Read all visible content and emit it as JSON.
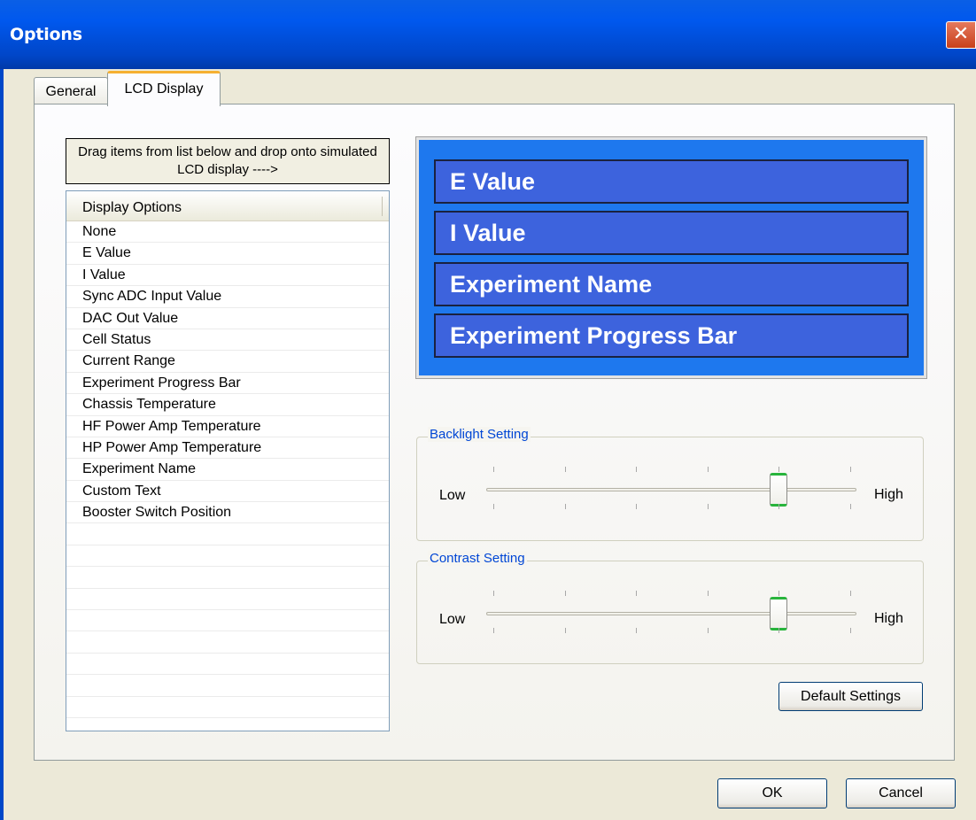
{
  "window": {
    "title": "Options",
    "close_glyph": "✕"
  },
  "tabs": [
    {
      "label": "General",
      "active": false
    },
    {
      "label": "LCD Display",
      "active": true
    }
  ],
  "left": {
    "hint": "Drag items from list below and drop onto simulated LCD display ---->",
    "list_header": "Display Options",
    "items": [
      "None",
      "E Value",
      "I Value",
      "Sync ADC Input Value",
      "DAC Out Value",
      "Cell Status",
      "Current Range",
      "Experiment Progress Bar",
      "Chassis Temperature",
      "HF Power Amp Temperature",
      "HP Power Amp Temperature",
      "Experiment Name",
      "Custom Text",
      "Booster Switch Position"
    ]
  },
  "lcd": {
    "lines": [
      "E Value",
      "I Value",
      "Experiment Name",
      "Experiment Progress Bar"
    ],
    "background_color": "#1e78ee",
    "line_color": "#3d63dd"
  },
  "backlight": {
    "title": "Backlight Setting",
    "low_label": "Low",
    "high_label": "High",
    "value_fraction": 0.8
  },
  "contrast": {
    "title": "Contrast Setting",
    "low_label": "Low",
    "high_label": "High",
    "value_fraction": 0.8
  },
  "buttons": {
    "defaults": "Default Settings",
    "ok": "OK",
    "cancel": "Cancel"
  }
}
